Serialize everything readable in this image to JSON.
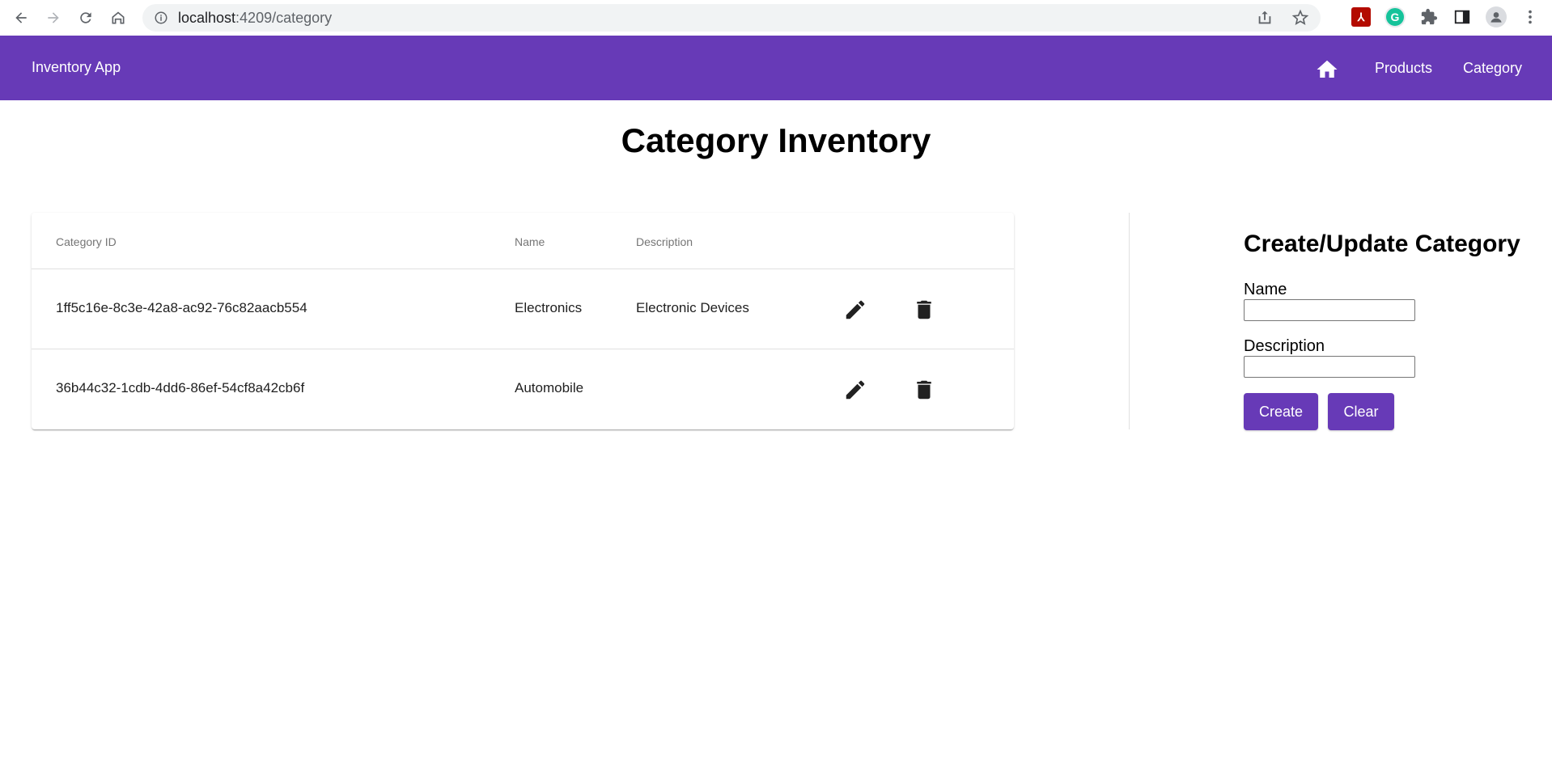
{
  "browser": {
    "url_host": "localhost",
    "url_path": ":4209/category"
  },
  "toolbar": {
    "app_title": "Inventory App",
    "nav": [
      {
        "icon": "home-icon"
      },
      {
        "label": "Products"
      },
      {
        "label": "Category"
      }
    ],
    "color": "#673ab7"
  },
  "page": {
    "title": "Category Inventory"
  },
  "table": {
    "columns": [
      "Category ID",
      "Name",
      "Description"
    ],
    "rows": [
      {
        "id": "1ff5c16e-8c3e-42a8-ac92-76c82aacb554",
        "name": "Electronics",
        "description": "Electronic Devices"
      },
      {
        "id": "36b44c32-1cdb-4dd6-86ef-54cf8a42cb6f",
        "name": "Automobile",
        "description": ""
      }
    ],
    "row_actions": [
      "edit-icon",
      "delete-icon"
    ]
  },
  "form": {
    "title": "Create/Update Category",
    "name_label": "Name",
    "name_value": "",
    "description_label": "Description",
    "description_value": "",
    "create_label": "Create",
    "clear_label": "Clear"
  }
}
